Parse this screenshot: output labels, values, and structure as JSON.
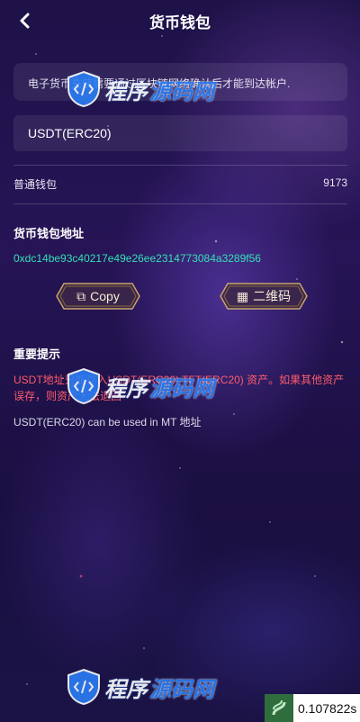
{
  "header": {
    "title": "货币钱包"
  },
  "notice": {
    "text": "电子货币充值需要通过区块链网络确认后才能到达帐户."
  },
  "network": {
    "selected": "USDT(ERC20)"
  },
  "wallet_type": {
    "label": "普通钱包",
    "value": "9173"
  },
  "address_section": {
    "title": "货币钱包地址",
    "address": "0xdc14be93c40217e49e26ee2314773084a3289f56"
  },
  "buttons": {
    "copy": "Copy",
    "qrcode": "二维码"
  },
  "tips": {
    "title": "重要提示",
    "warning": "USDT地址只能存入USDT(ERC20) TFT(ERC20) 资产。如果其他资产误存，则资产无法退回",
    "info": "USDT(ERC20) can be used in MT 地址"
  },
  "watermark": {
    "text1": "程序",
    "text2": "源码网"
  },
  "timer": {
    "value": "0.107822s"
  },
  "colors": {
    "address": "#36e0b6",
    "warning": "#ff5c6b",
    "button_gold": "#c9a46a"
  }
}
